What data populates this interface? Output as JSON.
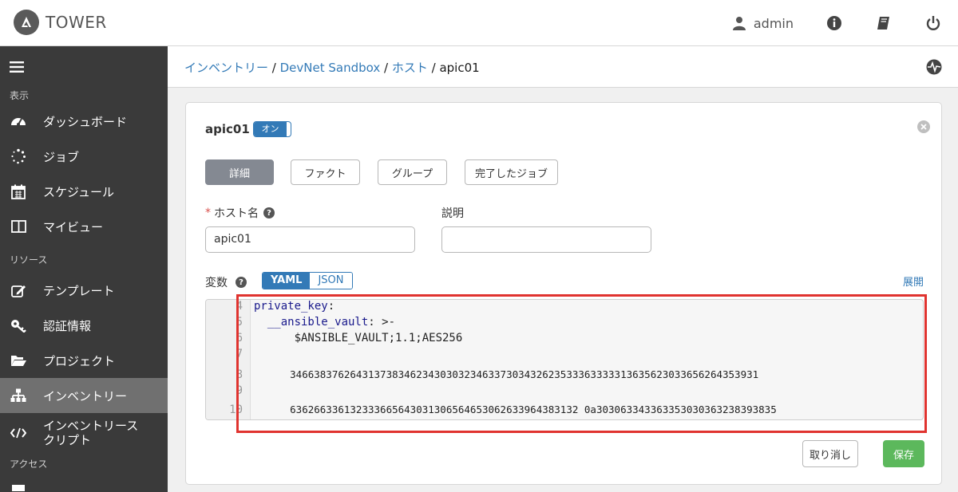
{
  "app": {
    "brand": "TOWER",
    "user": "admin"
  },
  "sidebar": {
    "sections": [
      "表示",
      "リソース",
      "アクセス"
    ],
    "items": [
      {
        "label": "ダッシュボード",
        "icon": "dashboard-icon"
      },
      {
        "label": "ジョブ",
        "icon": "jobs-spinner-icon"
      },
      {
        "label": "スケジュール",
        "icon": "calendar-icon"
      },
      {
        "label": "マイビュー",
        "icon": "my-view-icon"
      },
      {
        "label": "テンプレート",
        "icon": "edit-template-icon"
      },
      {
        "label": "認証情報",
        "icon": "key-icon"
      },
      {
        "label": "プロジェクト",
        "icon": "folder-open-icon"
      },
      {
        "label": "インベントリー",
        "icon": "sitemap-icon",
        "active": true
      },
      {
        "label": "インベントリースクリプト",
        "icon": "code-icon"
      }
    ]
  },
  "breadcrumb": {
    "items": [
      "インベントリー",
      "DevNet Sandbox",
      "ホスト",
      "apic01"
    ],
    "separator": " / "
  },
  "host": {
    "name": "apic01",
    "toggle_label": "オン"
  },
  "tabs": [
    "詳細",
    "ファクト",
    "グループ",
    "完了したジョブ"
  ],
  "form": {
    "host_name_label": "ホスト名",
    "host_name_value": "apic01",
    "description_label": "説明",
    "description_value": "",
    "variables_label": "変数",
    "format_options": [
      "YAML",
      "JSON"
    ],
    "format_selected": "YAML",
    "expand_label": "展開"
  },
  "editor": {
    "lines": [
      {
        "num": "4",
        "key": "private_key",
        "rest": ":"
      },
      {
        "num": "5",
        "key": "  __ansible_vault",
        "rest": ": >-"
      },
      {
        "num": "6",
        "key": "",
        "rest": "      $ANSIBLE_VAULT;1.1;AES256"
      },
      {
        "num": "7",
        "key": "",
        "rest": ""
      },
      {
        "num": "8",
        "key": "",
        "rest": "      346638376264313738346234303032346337303432623533363333313635623033656264353931"
      },
      {
        "num": "9",
        "key": "",
        "rest": ""
      },
      {
        "num": "10",
        "key": "",
        "rest": "      636266336132333665643031306564653062633964383132 0a303063343363353030363238393835"
      }
    ]
  },
  "actions": {
    "cancel": "取り消し",
    "save": "保存"
  },
  "colors": {
    "accent": "#337ab7",
    "save": "#5cb85c",
    "highlight": "#e0332f",
    "sidebar": "#3a3a3a"
  }
}
